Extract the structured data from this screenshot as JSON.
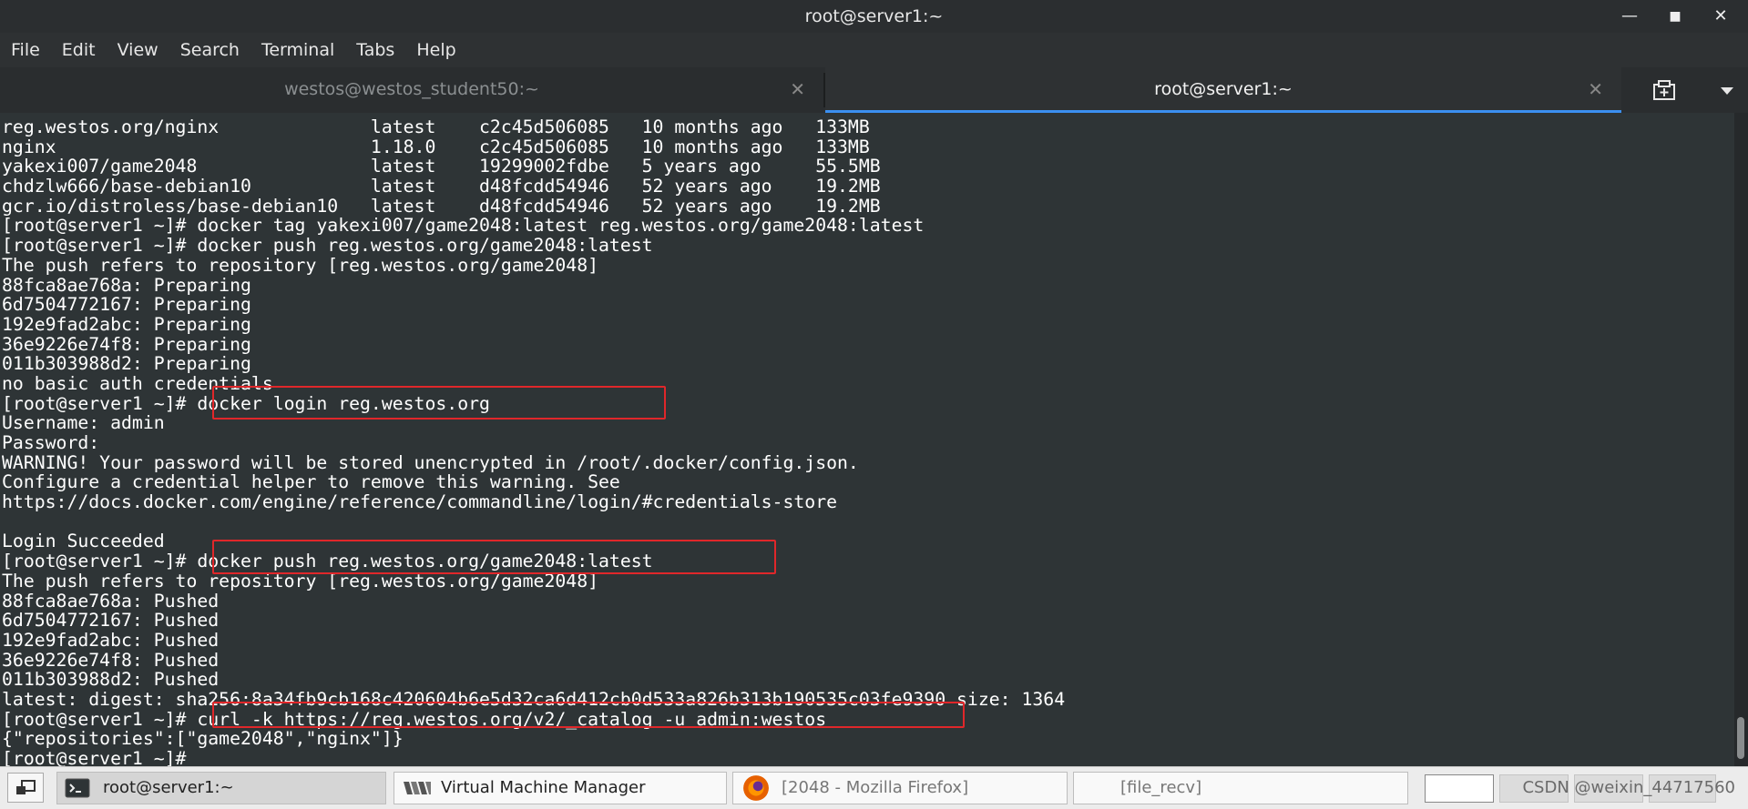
{
  "window": {
    "title": "root@server1:~"
  },
  "menu": [
    "File",
    "Edit",
    "View",
    "Search",
    "Terminal",
    "Tabs",
    "Help"
  ],
  "tabs": [
    {
      "label": "westos@westos_student50:~",
      "active": false
    },
    {
      "label": "root@server1:~",
      "active": true
    }
  ],
  "terminal_lines": [
    "reg.westos.org/nginx              latest    c2c45d506085   10 months ago   133MB",
    "nginx                             1.18.0    c2c45d506085   10 months ago   133MB",
    "yakexi007/game2048                latest    19299002fdbe   5 years ago     55.5MB",
    "chdzlw666/base-debian10           latest    d48fcdd54946   52 years ago    19.2MB",
    "gcr.io/distroless/base-debian10   latest    d48fcdd54946   52 years ago    19.2MB",
    "[root@server1 ~]# docker tag yakexi007/game2048:latest reg.westos.org/game2048:latest",
    "[root@server1 ~]# docker push reg.westos.org/game2048:latest",
    "The push refers to repository [reg.westos.org/game2048]",
    "88fca8ae768a: Preparing",
    "6d7504772167: Preparing",
    "192e9fad2abc: Preparing",
    "36e9226e74f8: Preparing",
    "011b303988d2: Preparing",
    "no basic auth credentials",
    "[root@server1 ~]# docker login reg.westos.org",
    "Username: admin",
    "Password:",
    "WARNING! Your password will be stored unencrypted in /root/.docker/config.json.",
    "Configure a credential helper to remove this warning. See",
    "https://docs.docker.com/engine/reference/commandline/login/#credentials-store",
    "",
    "Login Succeeded",
    "[root@server1 ~]# docker push reg.westos.org/game2048:latest",
    "The push refers to repository [reg.westos.org/game2048]",
    "88fca8ae768a: Pushed",
    "6d7504772167: Pushed",
    "192e9fad2abc: Pushed",
    "36e9226e74f8: Pushed",
    "011b303988d2: Pushed",
    "latest: digest: sha256:8a34fb9cb168c420604b6e5d32ca6d412cb0d533a826b313b190535c03fe9390 size: 1364",
    "[root@server1 ~]# curl -k https://reg.westos.org/v2/_catalog -u admin:westos",
    "{\"repositories\":[\"game2048\",\"nginx\"]}",
    "[root@server1 ~]#"
  ],
  "taskbar": {
    "items": [
      {
        "label": "root@server1:~",
        "icon": "terminal-icon",
        "active": true
      },
      {
        "label": "Virtual Machine Manager",
        "icon": "vmm-icon",
        "active": false
      },
      {
        "label": "[2048 - Mozilla Firefox]",
        "icon": "firefox-icon",
        "active": false
      },
      {
        "label": "[file_recv]",
        "icon": "",
        "active": false
      }
    ],
    "watermark": "CSDN @weixin_44717560"
  },
  "colors": {
    "terminal_bg": "#2e3436",
    "highlight": "#e0272a",
    "active_tab_underline": "#3b8ff0"
  }
}
